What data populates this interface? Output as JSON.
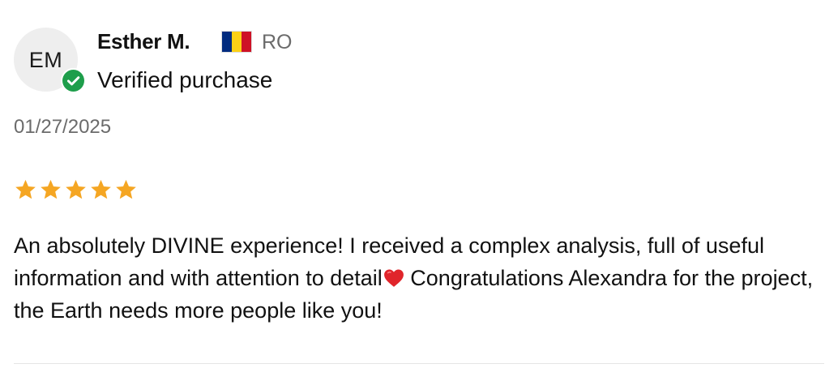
{
  "review": {
    "author": {
      "initials": "EM",
      "name": "Esther M.",
      "country_code": "RO",
      "flag_colors": [
        "#002B7F",
        "#FCD116",
        "#CE1126"
      ],
      "flag_icon": "romania-flag-icon"
    },
    "verified_label": "Verified purchase",
    "verified_icon": "check-circle-icon",
    "verified_color": "#1e9e4b",
    "date": "01/27/2025",
    "rating": 5,
    "rating_max": 5,
    "star_color": "#f5a623",
    "text_part1": "An absolutely DIVINE experience! I received a complex analysis, full of useful information and with attention to detail",
    "heart_icon": "red-heart-icon",
    "text_part2": " Congratulations Alexandra for the project, the Earth needs more people like you!"
  }
}
